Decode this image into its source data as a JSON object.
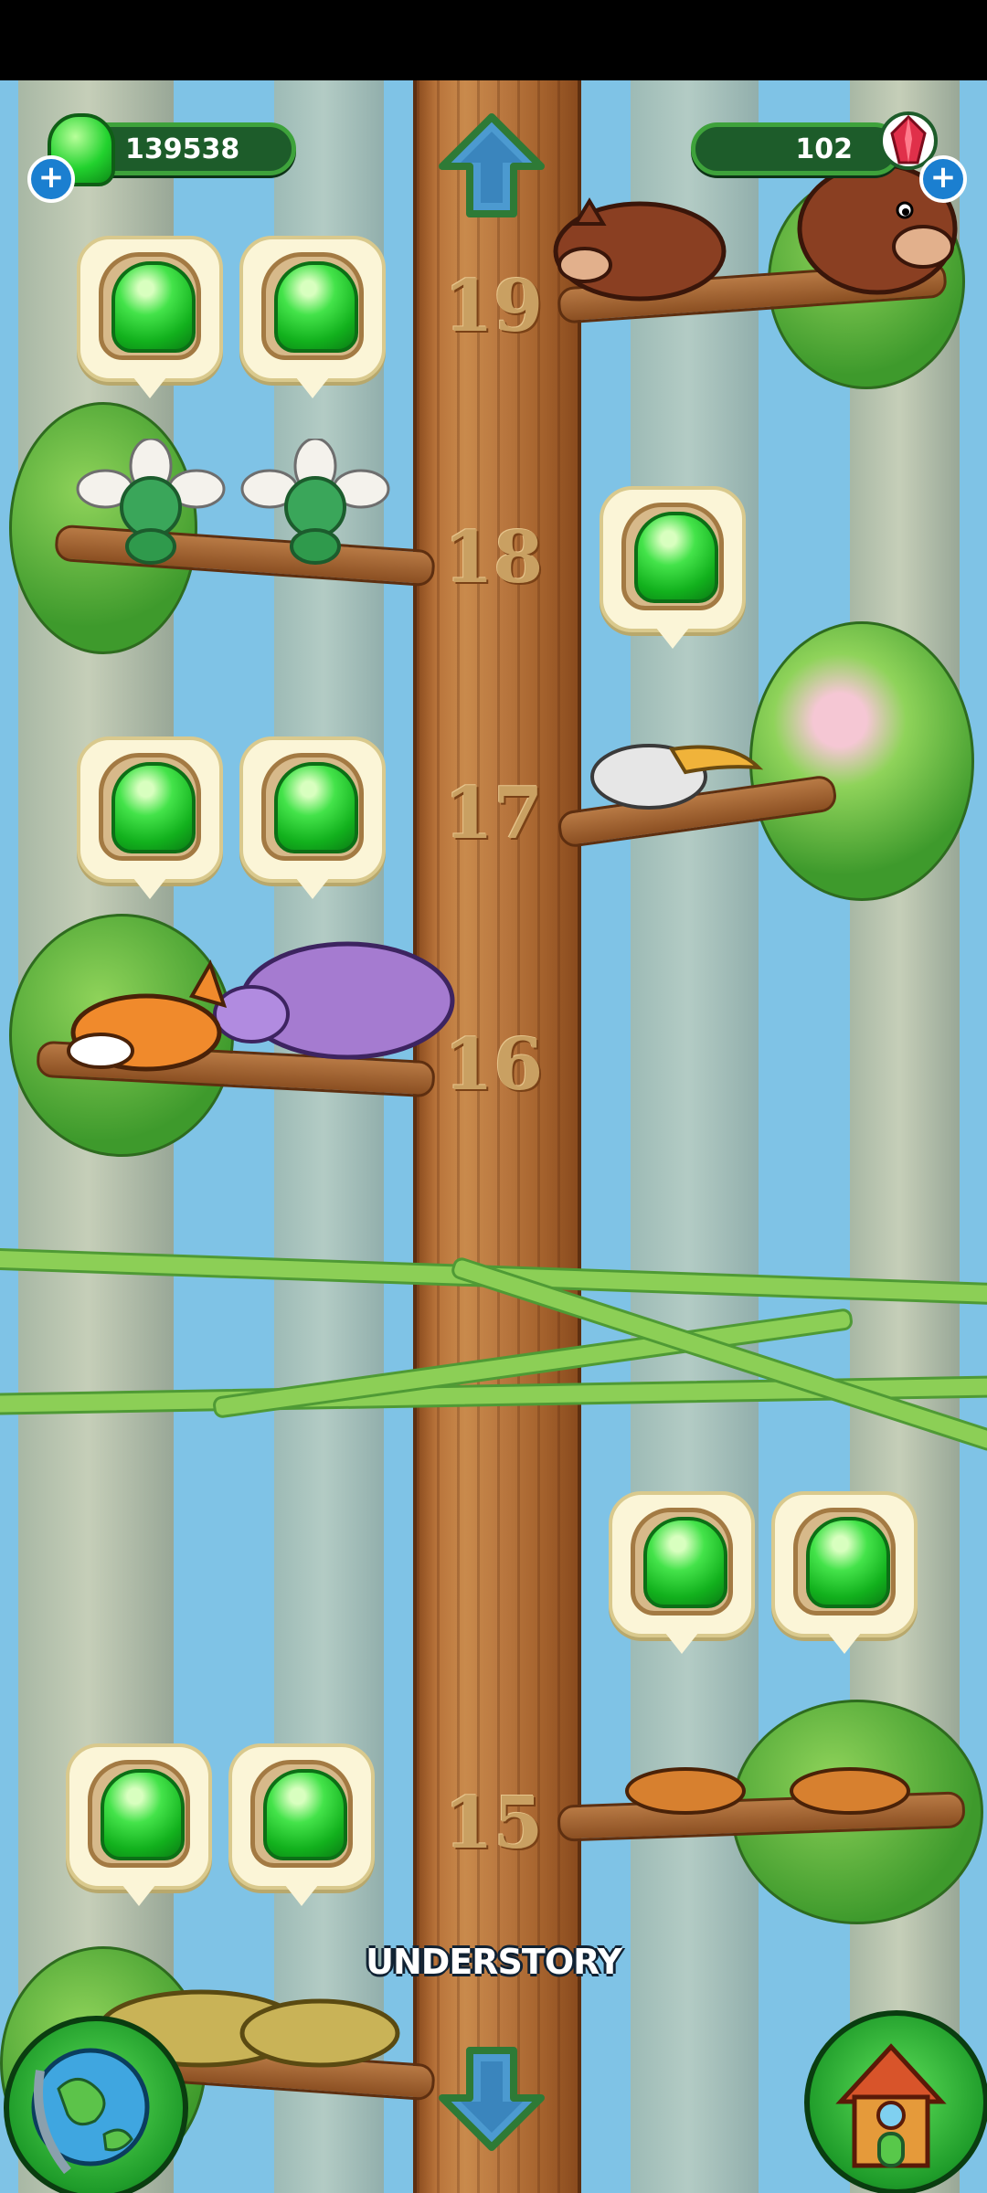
{
  "hud": {
    "gems": "139538",
    "crystals": "102"
  },
  "levels": [
    "19",
    "18",
    "17",
    "16",
    "15"
  ],
  "area_label": "UNDERSTORY",
  "colors": {
    "sky": "#7fc3e6",
    "trunk": "#b8733a",
    "gem_green": "#22d22e",
    "hud_bg": "#1d5c2a",
    "plus_blue": "#1b7fd0",
    "crystal_red": "#e0304a"
  },
  "icons": {
    "gem": "green-gem-icon",
    "crystal": "red-crystal-icon",
    "up": "up-arrow-icon",
    "down": "down-arrow-icon",
    "globe": "globe-icon",
    "house": "house-icon"
  },
  "resource_bubbles": {
    "count": 9,
    "reward": "green-gem"
  }
}
